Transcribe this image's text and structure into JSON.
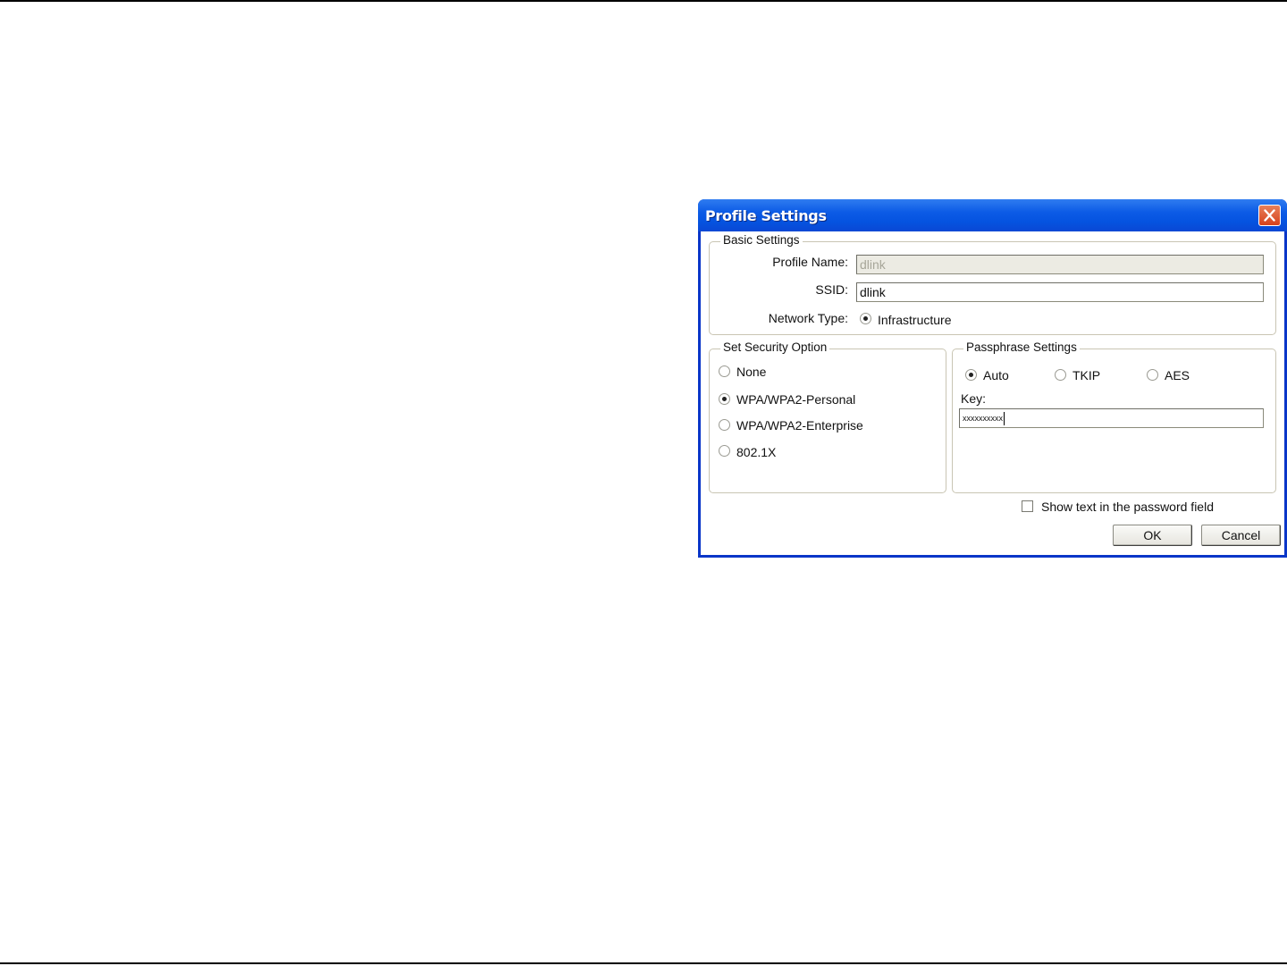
{
  "dialog": {
    "title": "Profile Settings",
    "close_icon": "close-icon"
  },
  "basic_settings": {
    "legend": "Basic Settings",
    "profile_name_label": "Profile Name:",
    "profile_name_value": "dlink",
    "ssid_label": "SSID:",
    "ssid_value": "dlink",
    "network_type_label": "Network Type:",
    "network_type_option": "Infrastructure"
  },
  "security": {
    "legend": "Set Security Option",
    "options": [
      "None",
      "WPA/WPA2-Personal",
      "WPA/WPA2-Enterprise",
      "802.1X"
    ],
    "selected": "WPA/WPA2-Personal"
  },
  "passphrase": {
    "legend": "Passphrase Settings",
    "options": [
      "Auto",
      "TKIP",
      "AES"
    ],
    "selected": "Auto",
    "key_label": "Key:",
    "key_value": "xxxxxxxxxx"
  },
  "show_text_label": "Show text in the password field",
  "buttons": {
    "ok": "OK",
    "cancel": "Cancel"
  },
  "colors": {
    "titlebar": "#0553e0",
    "close": "#d6421c"
  }
}
